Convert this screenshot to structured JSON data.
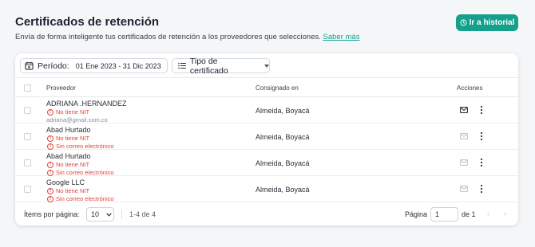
{
  "header": {
    "title": "Certificados de retención",
    "subtitle": "Envía de forma inteligente tus certificados de retención a los proveedores que selecciones.",
    "learn_more": "Saber más",
    "history_button": "Ir a historial"
  },
  "filters": {
    "period_label": "Período:",
    "period_value": "01 Ene 2023 - 31 Dic 2023",
    "type_label": "Tipo de certificado"
  },
  "table": {
    "columns": [
      "Proveedor",
      "Consignado en",
      "Acciones"
    ],
    "rows": [
      {
        "name": "ADRIANA .HERNANDEZ",
        "warnings": [
          "No tiene NIT"
        ],
        "email": "adriana@gmail.com.co",
        "city": "Almeida, Boyacá",
        "mail_enabled": true
      },
      {
        "name": "Abad Hurtado",
        "warnings": [
          "No tiene NIT",
          "Sin correo electrónico"
        ],
        "email": "",
        "city": "Almeida, Boyacá",
        "mail_enabled": false
      },
      {
        "name": "Abad Hurtado",
        "warnings": [
          "No tiene NIT",
          "Sin correo electrónico"
        ],
        "email": "",
        "city": "Almeida, Boyacá",
        "mail_enabled": false
      },
      {
        "name": "Google LLC",
        "warnings": [
          "No tiene NIT",
          "Sin correo electrónico"
        ],
        "email": "",
        "city": "Almeida, Boyacá",
        "mail_enabled": false
      }
    ]
  },
  "pagination": {
    "items_per_page_label": "Ítems por página:",
    "items_per_page": "10",
    "range": "1-4 de 4",
    "page_label": "Página",
    "page": "1",
    "of_pages": "de 1",
    "prev": "‹",
    "next": "›"
  },
  "colors": {
    "accent": "#14a08a",
    "warning": "#e0433a"
  }
}
